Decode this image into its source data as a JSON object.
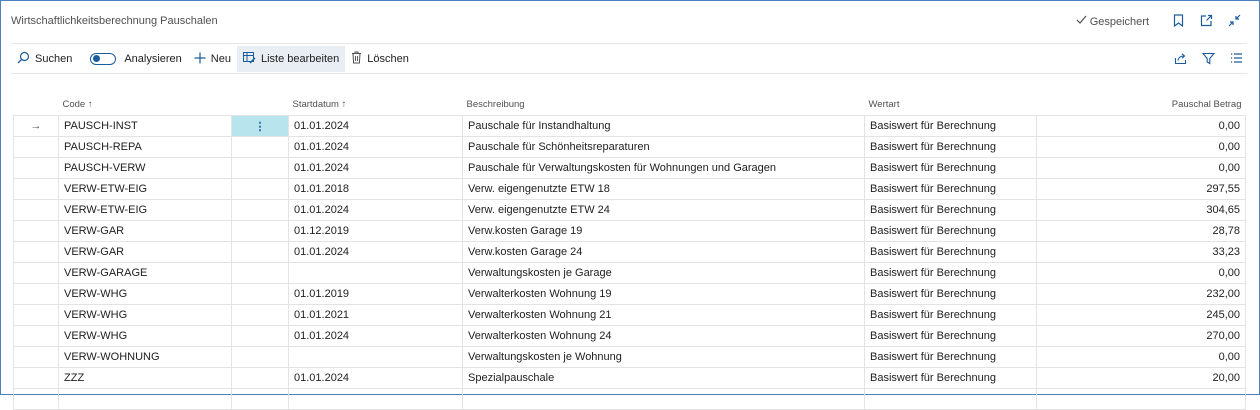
{
  "window": {
    "title": "Wirtschaftlichkeitsberechnung Pauschalen",
    "saved_label": "Gespeichert"
  },
  "toolbar": {
    "search_label": "Suchen",
    "analyze_label": "Analysieren",
    "new_label": "Neu",
    "edit_list_label": "Liste bearbeiten",
    "delete_label": "Löschen"
  },
  "table": {
    "columns": {
      "code": "Code",
      "startdate": "Startdatum",
      "description": "Beschreibung",
      "valuetype": "Wertart",
      "amount": "Pauschal Betrag"
    },
    "rows": [
      {
        "code": "PAUSCH-INST",
        "start": "01.01.2024",
        "desc": "Pauschale für Instandhaltung",
        "type": "Basiswert für Berechnung",
        "amount": "0,00"
      },
      {
        "code": "PAUSCH-REPA",
        "start": "01.01.2024",
        "desc": "Pauschale für Schönheitsreparaturen",
        "type": "Basiswert für Berechnung",
        "amount": "0,00"
      },
      {
        "code": "PAUSCH-VERW",
        "start": "01.01.2024",
        "desc": "Pauschale für Verwaltungskosten für Wohnungen und Garagen",
        "type": "Basiswert für Berechnung",
        "amount": "0,00"
      },
      {
        "code": "VERW-ETW-EIG",
        "start": "01.01.2018",
        "desc": "Verw. eigengenutzte ETW 18",
        "type": "Basiswert für Berechnung",
        "amount": "297,55"
      },
      {
        "code": "VERW-ETW-EIG",
        "start": "01.01.2024",
        "desc": "Verw. eigengenutzte ETW 24",
        "type": "Basiswert für Berechnung",
        "amount": "304,65"
      },
      {
        "code": "VERW-GAR",
        "start": "01.12.2019",
        "desc": "Verw.kosten Garage 19",
        "type": "Basiswert für Berechnung",
        "amount": "28,78"
      },
      {
        "code": "VERW-GAR",
        "start": "01.01.2024",
        "desc": "Verw.kosten Garage 24",
        "type": "Basiswert für Berechnung",
        "amount": "33,23"
      },
      {
        "code": "VERW-GARAGE",
        "start": "",
        "desc": "Verwaltungskosten je Garage",
        "type": "Basiswert für Berechnung",
        "amount": "0,00"
      },
      {
        "code": "VERW-WHG",
        "start": "01.01.2019",
        "desc": "Verwalterkosten Wohnung 19",
        "type": "Basiswert für Berechnung",
        "amount": "232,00"
      },
      {
        "code": "VERW-WHG",
        "start": "01.01.2021",
        "desc": "Verwalterkosten Wohnung 21",
        "type": "Basiswert für Berechnung",
        "amount": "245,00"
      },
      {
        "code": "VERW-WHG",
        "start": "01.01.2024",
        "desc": "Verwalterkosten Wohnung 24",
        "type": "Basiswert für Berechnung",
        "amount": "270,00"
      },
      {
        "code": "VERW-WOHNUNG",
        "start": "",
        "desc": "Verwaltungskosten je Wohnung",
        "type": "Basiswert für Berechnung",
        "amount": "0,00"
      },
      {
        "code": "ZZZ",
        "start": "01.01.2024",
        "desc": "Spezialpauschale",
        "type": "Basiswert für Berechnung",
        "amount": "20,00"
      },
      {
        "code": "",
        "start": "",
        "desc": "",
        "type": "",
        "amount": ""
      }
    ]
  },
  "colors": {
    "accent": "#1a5d9e",
    "frame": "#4a7fc1",
    "selected_cell": "#b8e4ee"
  }
}
